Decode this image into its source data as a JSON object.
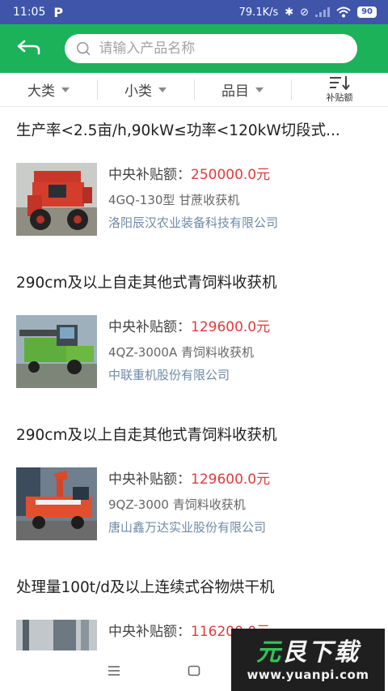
{
  "status_bar": {
    "time": "11:05",
    "app_icon": "P",
    "net_speed": "79.1K/s",
    "battery": "90",
    "icons": [
      "bluetooth-icon",
      "alarm-off-icon",
      "signal-icon",
      "wifi-icon",
      "battery-icon"
    ]
  },
  "header": {
    "back_icon": "back-arrow-icon",
    "search_placeholder": "请输入产品名称",
    "bg_color": "#1bb25a"
  },
  "filters": {
    "category": "大类",
    "subcategory": "小类",
    "item": "品目",
    "sort_label": "补贴额"
  },
  "products": [
    {
      "title": "生产率<2.5亩/h,90kW≤功率<120kW切段式...",
      "subsidy_label": "中央补贴额：",
      "subsidy_amount": "250000.0元",
      "model": "4GQ-130型 甘蔗收获机",
      "company": "洛阳辰汉农业装备科技有限公司"
    },
    {
      "title": "290cm及以上自走其他式青饲料收获机",
      "subsidy_label": "中央补贴额：",
      "subsidy_amount": "129600.0元",
      "model": "4QZ-3000A 青饲料收获机",
      "company": "中联重机股份有限公司"
    },
    {
      "title": "290cm及以上自走其他式青饲料收获机",
      "subsidy_label": "中央补贴额：",
      "subsidy_amount": "129600.0元",
      "model": "9QZ-3000 青饲料收获机",
      "company": "唐山鑫万达实业股份有限公司"
    },
    {
      "title": "处理量100t/d及以上连续式谷物烘干机",
      "subsidy_label": "中央补贴额：",
      "subsidy_amount": "116200.0元",
      "model": "",
      "company": ""
    }
  ],
  "watermark": {
    "title_part1": "元",
    "title_part2": "艮",
    "title_part3": "下载",
    "url": "www.yuanpi.com"
  },
  "nav": {
    "icons": [
      "menu-icon",
      "home-icon"
    ]
  }
}
